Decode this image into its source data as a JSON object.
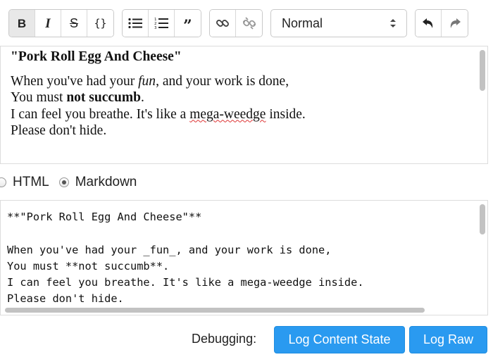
{
  "toolbar": {
    "inline_styles": [
      {
        "name": "bold",
        "glyph": "B",
        "active": true
      },
      {
        "name": "italic",
        "glyph": "I",
        "active": false
      },
      {
        "name": "strikethrough",
        "glyph": "S",
        "active": false
      },
      {
        "name": "code",
        "glyph": "{}",
        "active": false
      }
    ],
    "block_styles": [
      {
        "name": "unordered-list"
      },
      {
        "name": "ordered-list"
      },
      {
        "name": "blockquote",
        "glyph": "”"
      }
    ],
    "link_buttons": [
      {
        "name": "link"
      },
      {
        "name": "unlink"
      }
    ],
    "block_type_select": {
      "value": "Normal"
    },
    "history_buttons": [
      {
        "name": "undo"
      },
      {
        "name": "redo"
      }
    ]
  },
  "rich_editor": {
    "title": "\"Pork Roll Egg And Cheese\"",
    "line1_before": "When you've had your ",
    "line1_italic": "fun",
    "line1_after": ", and your work is done,",
    "line2_before": "You must ",
    "line2_bold": "not succumb",
    "line2_after": ".",
    "line3_before": "I can feel you breathe. It's like a ",
    "line3_misspelled": "mega-weedge",
    "line3_after": " inside.",
    "line4": "Please don't hide."
  },
  "format_options": {
    "html_label": "HTML",
    "markdown_label": "Markdown",
    "selected": "markdown"
  },
  "raw_editor": {
    "text": "**\"Pork Roll Egg And Cheese\"**\n\nWhen you've had your _fun_, and your work is done,\nYou must **not succumb**.\nI can feel you breathe. It's like a mega-weedge inside.\nPlease don't hide."
  },
  "debug": {
    "label": "Debugging:",
    "log_content_state": "Log Content State",
    "log_raw": "Log Raw"
  },
  "colors": {
    "primary_button": "#2a9af0",
    "active_toolbar_button": "#e8e8e8",
    "spellcheck_underline": "#d33"
  }
}
